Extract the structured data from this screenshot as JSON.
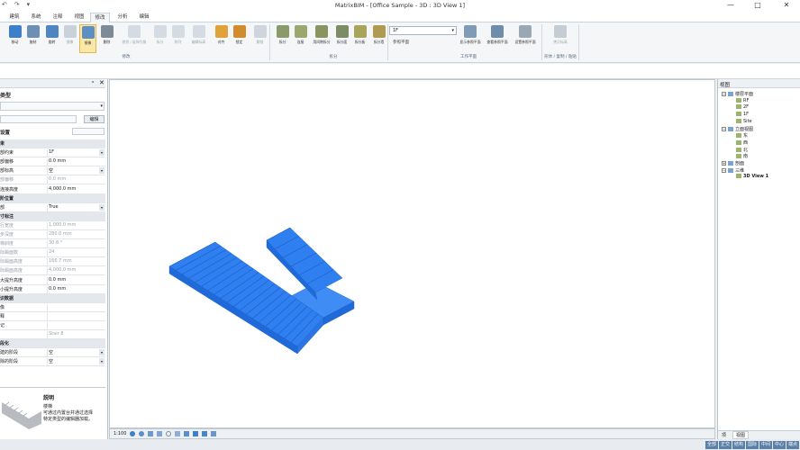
{
  "window": {
    "title": "MatrixBIM - [Office Sample - 3D : 3D View 1]",
    "min": "—",
    "max": "□",
    "close": "✕"
  },
  "qat": [
    "↶",
    "↷",
    "▾"
  ],
  "tabs": [
    "建筑",
    "系统",
    "注释",
    "视图",
    "修改",
    "分析",
    "编辑"
  ],
  "active_tab": "修改",
  "ribbon": {
    "groups": [
      {
        "label": "修改",
        "buttons": [
          "移动",
          "复制",
          "旋转",
          "镜像",
          "镜像",
          "删除",
          "修剪 / 延伸为角",
          "拆分",
          "阵列",
          "编辑标高",
          "对齐",
          "锁定",
          "解锁"
        ]
      },
      {
        "label": "拆分",
        "buttons": [
          "拆分",
          "连接",
          "用间隙拆分",
          "拆分面",
          "拆分板",
          "拆分墙"
        ]
      },
      {
        "label": "工作平面",
        "combo_value": "1F",
        "combo_label": "参照平面",
        "buttons": [
          "显示参照平面",
          "查看参照平面",
          "设置参照平面"
        ]
      },
      {
        "label": "形体 / 复制 / 粘贴",
        "buttons": [
          "拷贝标高"
        ]
      }
    ]
  },
  "properties": {
    "header": "类型",
    "edit_type": "编辑",
    "settings_label": "设置",
    "rows": [
      {
        "k": "束",
        "v": "",
        "hdr": true
      },
      {
        "k": "部约束",
        "v": "1F",
        "sel": true
      },
      {
        "k": "部偏移",
        "v": "0.0 mm"
      },
      {
        "k": "部标高",
        "v": "空",
        "sel": true
      },
      {
        "k": "部偏移",
        "v": "0.0 mm",
        "gray": true
      },
      {
        "k": "连接高度",
        "v": "4,000.0 mm"
      },
      {
        "k": "阶位置",
        "v": "",
        "hdr": true
      },
      {
        "k": "部",
        "v": "True",
        "sel": true
      },
      {
        "k": "寸标注",
        "v": "",
        "hdr": true
      },
      {
        "k": "行宽度",
        "v": "1,000.0 mm",
        "gray": true
      },
      {
        "k": "步深度",
        "v": "280.0 mm",
        "gray": true
      },
      {
        "k": "梯斜度",
        "v": "30.8 °",
        "gray": true
      },
      {
        "k": "际踢面数",
        "v": "24",
        "gray": true
      },
      {
        "k": "际踢面高度",
        "v": "166.7 mm",
        "gray": true
      },
      {
        "k": "际踢面高度",
        "v": "4,000.0 mm",
        "gray": true
      },
      {
        "k": "大提升高度",
        "v": "0.0 mm"
      },
      {
        "k": "小提升高度",
        "v": "0.0 mm"
      },
      {
        "k": "识数据",
        "v": "",
        "hdr": true
      },
      {
        "k": "像",
        "v": ""
      },
      {
        "k": "释",
        "v": ""
      },
      {
        "k": "记",
        "v": ""
      },
      {
        "k": "",
        "v": "Stair 8",
        "gray": true
      },
      {
        "k": "段化",
        "v": "",
        "hdr": true
      },
      {
        "k": "建的阶段",
        "v": "空",
        "sel": true
      },
      {
        "k": "除的阶段",
        "v": "空",
        "sel": true
      }
    ],
    "preview": {
      "title": "説明",
      "name": "楼梯",
      "desc1": "可通过内置台并通过选择",
      "desc2": "特定类型的编辑器加载。"
    }
  },
  "statusbar": {
    "scale": "1:100"
  },
  "tree": {
    "title": "视图",
    "nodes": [
      {
        "label": "楼层平面",
        "level": 0,
        "exp": "⊟"
      },
      {
        "label": "RF",
        "level": 1
      },
      {
        "label": "2F",
        "level": 1
      },
      {
        "label": "1F",
        "level": 1
      },
      {
        "label": "Site",
        "level": 1
      },
      {
        "label": "立面视图",
        "level": 0,
        "exp": "⊟"
      },
      {
        "label": "东",
        "level": 1
      },
      {
        "label": "西",
        "level": 1
      },
      {
        "label": "北",
        "level": 1
      },
      {
        "label": "南",
        "level": 1
      },
      {
        "label": "剖面",
        "level": 0,
        "exp": "⊞"
      },
      {
        "label": "三维",
        "level": 0,
        "exp": "⊟"
      },
      {
        "label": "3D View 1",
        "level": 1,
        "bold": true
      }
    ],
    "bottom_tabs": [
      "项",
      "视图"
    ]
  },
  "bottom_tags": [
    "全部",
    "正交",
    "结构",
    "国际",
    "中间",
    "中心",
    "端点"
  ],
  "colors": {
    "stair": "#2f7ff0",
    "accent": "#5a7fa8",
    "selected": "#fbe7a6"
  }
}
